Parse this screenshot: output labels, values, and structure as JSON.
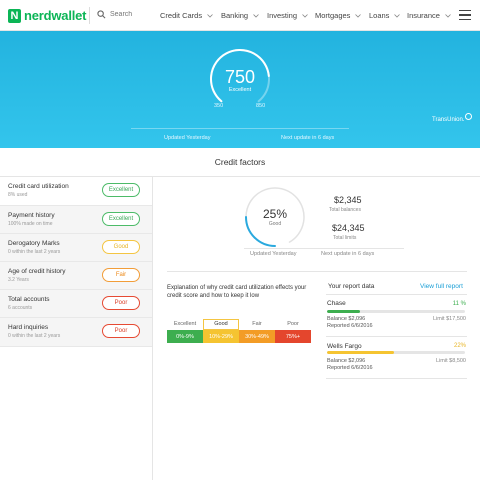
{
  "nav": {
    "brand": "nerdwallet",
    "brand_initial": "N",
    "search_placeholder": "Search",
    "menu": [
      "Credit Cards",
      "Banking",
      "Investing",
      "Mortgages",
      "Loans",
      "Insurance"
    ]
  },
  "hero": {
    "score": "750",
    "score_label": "Excellent",
    "range_min": "350",
    "range_max": "850",
    "score_fraction": 0.8,
    "updated": "Updated Yesterday",
    "next_update": "Next update in 6 days",
    "bureau": "TransUnion."
  },
  "factors": {
    "title": "Credit factors",
    "items": [
      {
        "name": "Credit card utilization",
        "sub": "8% used",
        "rating": "Excellent",
        "level": "excellent"
      },
      {
        "name": "Payment history",
        "sub": "100% made on time",
        "rating": "Excellent",
        "level": "excellent"
      },
      {
        "name": "Derogatory Marks",
        "sub": "0 within the last 2 years",
        "rating": "Good",
        "level": "good"
      },
      {
        "name": "Age of credit history",
        "sub": "3.2 Years",
        "rating": "Fair",
        "level": "fair"
      },
      {
        "name": "Total accounts",
        "sub": "6 accounts",
        "rating": "Poor",
        "level": "poor"
      },
      {
        "name": "Hard inquiries",
        "sub": "0 within the last 2 years",
        "rating": "Poor",
        "level": "poor"
      }
    ]
  },
  "utilization": {
    "percent": "25%",
    "label": "Good",
    "fraction": 0.25,
    "total_balances_value": "$2,345",
    "total_balances_label": "Total balances",
    "total_limits_value": "$24,345",
    "total_limits_label": "Total limits",
    "updated": "Updated Yesterday",
    "next_update": "Next update in 6 days"
  },
  "explanation": {
    "text": "Explanation of why credit card utilization effects your credit score and how to keep it low",
    "scale": [
      {
        "label": "Excellent",
        "range": "0%-9%",
        "color": "#3dae4f",
        "selected": false
      },
      {
        "label": "Good",
        "range": "10%-29%",
        "color": "#f5c431",
        "selected": true
      },
      {
        "label": "Fair",
        "range": "30%-49%",
        "color": "#f39c26",
        "selected": false
      },
      {
        "label": "Poor",
        "range": "75%+",
        "color": "#e4462d",
        "selected": false
      }
    ]
  },
  "report": {
    "title": "Your report data",
    "link": "View full report",
    "accounts": [
      {
        "name": "Chase",
        "percent": "11 %",
        "utilization": 0.11,
        "color": "#3dae4f",
        "pct_color": "#3dae4f",
        "balance": "Balance $2,096",
        "reported": "Reported 6/6/2016",
        "limit": "Limit $17,500"
      },
      {
        "name": "Wells Fargo",
        "percent": "22%",
        "utilization": 0.22,
        "color": "#f5c431",
        "pct_color": "#e7b526",
        "balance": "Balance $2,096",
        "reported": "Reported 6/6/2016",
        "limit": "Limit $8,500"
      }
    ]
  },
  "colors": {
    "brand": "#0bb556",
    "hero": "#2ab9e4",
    "excellent": "#3dae4f",
    "good": "#f5c431",
    "fair": "#f39c26",
    "poor": "#e4462d",
    "link": "#1a9fd6"
  }
}
